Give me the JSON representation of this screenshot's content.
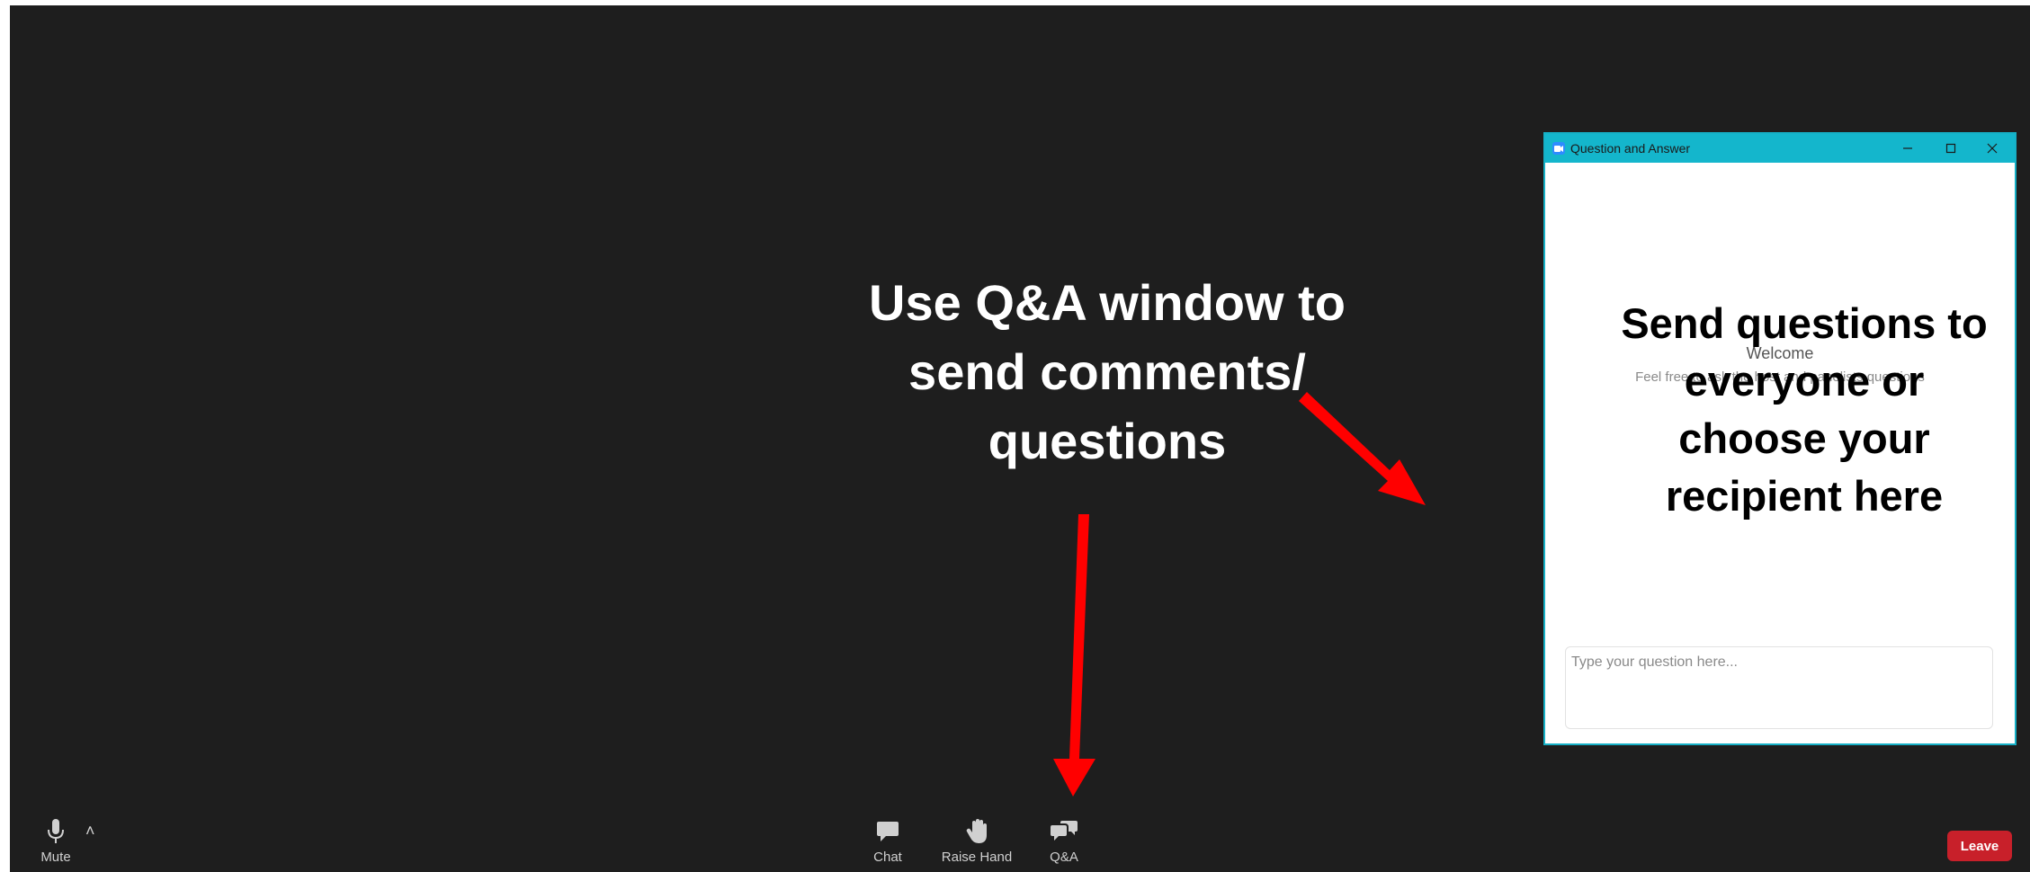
{
  "toolbar": {
    "mute_label": "Mute",
    "chat_label": "Chat",
    "raise_hand_label": "Raise Hand",
    "qa_label": "Q&A",
    "leave_label": "Leave"
  },
  "annotations": {
    "main": [
      "Use Q&A window to",
      "send comments/",
      "questions"
    ],
    "side": [
      "Send questions to",
      "everyone or",
      "choose your",
      "recipient here"
    ]
  },
  "qa_window": {
    "title": "Question and Answer",
    "welcome": "Welcome",
    "welcome_sub": "Feel free to ask the host and panelists questions",
    "input_placeholder": "Type your question here..."
  },
  "colors": {
    "stage_bg": "#1e1e1e",
    "titlebar": "#14b6cc",
    "leave": "#c8202a",
    "arrow": "#ff0000"
  }
}
